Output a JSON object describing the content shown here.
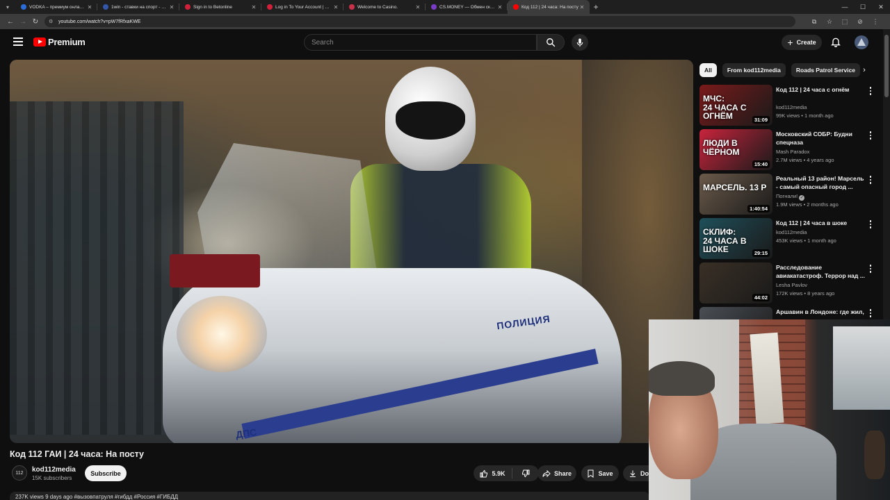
{
  "browser": {
    "tabs": [
      {
        "title": "VODKA – премиум онлайн-казино",
        "favicon_color": "#2a6cd8",
        "active": false
      },
      {
        "title": "1win - ставки на спорт - 57648",
        "favicon_color": "#3355aa",
        "active": false
      },
      {
        "title": "Sign in to Betonline",
        "favicon_color": "#d0203a",
        "active": false
      },
      {
        "title": "Log in To Your Account | BetOnline",
        "favicon_color": "#d0203a",
        "active": false
      },
      {
        "title": "Welcome to Casino.",
        "favicon_color": "#c9304a",
        "active": false
      },
      {
        "title": "CS.MONEY — Обмен скинов CS2",
        "favicon_color": "#7a3bc8",
        "active": false
      },
      {
        "title": "Код 112 | 24 часа: На посту",
        "favicon_color": "#ff0000",
        "active": true
      }
    ],
    "url": "youtube.com/watch?v=pW7fRfxaKWE"
  },
  "header": {
    "logo_text": "Premium",
    "search_placeholder": "Search",
    "create_label": "Create"
  },
  "video": {
    "title": "Код 112 ГАИ | 24 часа: На посту",
    "frame_text_police": "ПОЛИЦИЯ",
    "frame_text_dps": "ДПС",
    "channel": {
      "name": "kod112media",
      "subscribers": "15K subscribers",
      "avatar_text": "112"
    },
    "subscribe_label": "Subscribe",
    "likes": "5.9K",
    "share_label": "Share",
    "save_label": "Save",
    "download_label": "Dov",
    "description_peek": "237K views  9 days ago  #вызовпатруля #гибдд #Россия #ГИБДД"
  },
  "chips": [
    "All",
    "From kod112media",
    "Roads Patrol Service"
  ],
  "recommendations": [
    {
      "title": "Код 112 | 24 часа с огнём",
      "channel": "kod112media",
      "verified": false,
      "meta": "99K views • 1 month ago",
      "duration": "31:09",
      "thumb_text": "МЧС:\n24 ЧАСА С ОГНЁМ",
      "thumb_color": "#7a1a1a"
    },
    {
      "title": "Московский СОБР: Будни спецназа",
      "channel": "Mash Paradox",
      "verified": false,
      "meta": "2.7M views • 4 years ago",
      "duration": "15:40",
      "thumb_text": "ЛЮДИ В ЧЁРНОМ",
      "thumb_color": "#c8243c"
    },
    {
      "title": "Реальный 13 район! Марсель - самый опасный город ...",
      "channel": "Погнали!",
      "verified": true,
      "meta": "1.9M views • 2 months ago",
      "duration": "1:40:54",
      "thumb_text": "МАРСЕЛЬ. 13 Р",
      "thumb_color": "#6b5a4a"
    },
    {
      "title": "Код 112 | 24 часа в шоке",
      "channel": "kod112media",
      "verified": false,
      "meta": "453K views • 1 month ago",
      "duration": "29:15",
      "thumb_text": "СКЛИФ:\n24 ЧАСА В ШОКЕ",
      "thumb_color": "#1f4f5a"
    },
    {
      "title": "Расследование авиакатастроф. Террор над ...",
      "channel": "Lesha Pavlov",
      "verified": false,
      "meta": "172K views • 8 years ago",
      "duration": "44:02",
      "thumb_text": "",
      "thumb_color": "#3a3026"
    },
    {
      "title": "Аршавин в Лондоне: где жил,",
      "channel": "",
      "verified": false,
      "meta": "",
      "duration": "",
      "thumb_text": "",
      "thumb_color": "#4a4f55"
    }
  ]
}
